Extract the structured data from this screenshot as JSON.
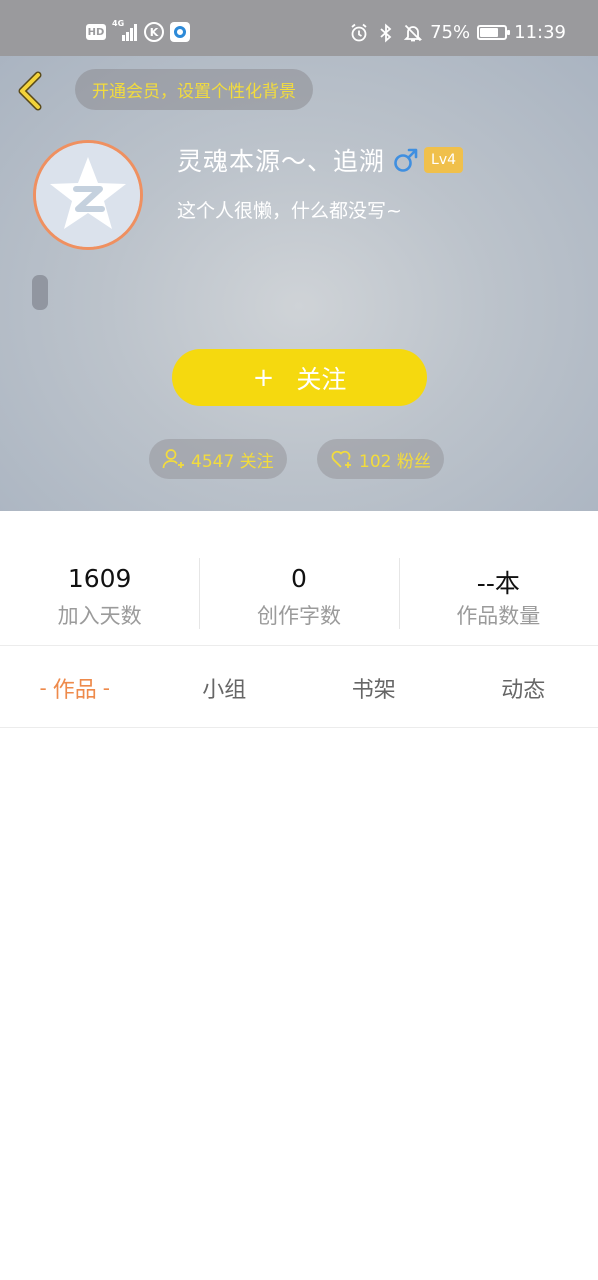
{
  "status_bar": {
    "network_badge": "HD",
    "network_type": "4G",
    "k_icon_label": "K",
    "battery_percent": "75%",
    "battery_level": 0.75,
    "time": "11:39",
    "icons": [
      "alarm-icon",
      "bluetooth-icon",
      "mute-icon",
      "battery-icon"
    ]
  },
  "header": {
    "vip_banner": "开通会员，设置个性化背景",
    "username": "灵魂本源～、追溯",
    "gender": "male",
    "level": "Lv4",
    "bio": "这个人很懒，什么都没写~",
    "follow_plus": "+",
    "follow_label": "关注",
    "following": "4547 关注",
    "fans": "102 粉丝",
    "accent_color": "#f5d90f",
    "gender_color": "#3f8fe0",
    "level_color": "#f0c04b"
  },
  "stats": [
    {
      "value": "1609",
      "label": "加入天数"
    },
    {
      "value": "0",
      "label": "创作字数"
    },
    {
      "value": "--本",
      "label": "作品数量"
    }
  ],
  "tabs": [
    {
      "label": "作品",
      "active": true
    },
    {
      "label": "小组",
      "active": false
    },
    {
      "label": "书架",
      "active": false
    },
    {
      "label": "动态",
      "active": false
    }
  ],
  "active_tab_color": "#ee8a4b"
}
